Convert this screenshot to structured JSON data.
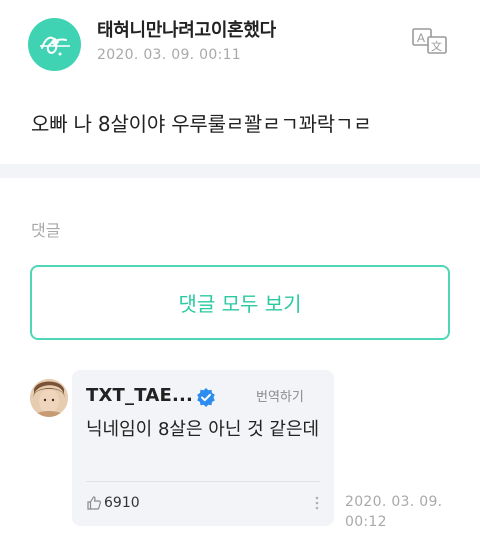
{
  "post": {
    "author": "태혀니만나려고이혼했다",
    "timestamp": "2020. 03. 09. 00:11",
    "body": "오빠 나 8살이야 우루룰ㄹ꽐ㄹㄱ꽈락ㄱㄹ",
    "avatar_icon": "signature-logo",
    "translate_icon": "translate-icon"
  },
  "comments_section": {
    "label": "댓글",
    "view_all_label": "댓글 모두 보기"
  },
  "comment": {
    "author": "TXT_TAE...",
    "verified_icon": "verified-badge-icon",
    "translate_label": "번역하기",
    "text": "닉네임이 8살은 아닌 것 같은데",
    "likes": "6910",
    "time_line1": "2020. 03. 09.",
    "time_line2": "00:12"
  },
  "colors": {
    "accent": "#2ccaa2",
    "border_accent": "#4fd6b7",
    "bubble_bg": "#f2f4f8",
    "muted_text": "#a9a9a9",
    "verified_blue": "#2d8cf0"
  }
}
